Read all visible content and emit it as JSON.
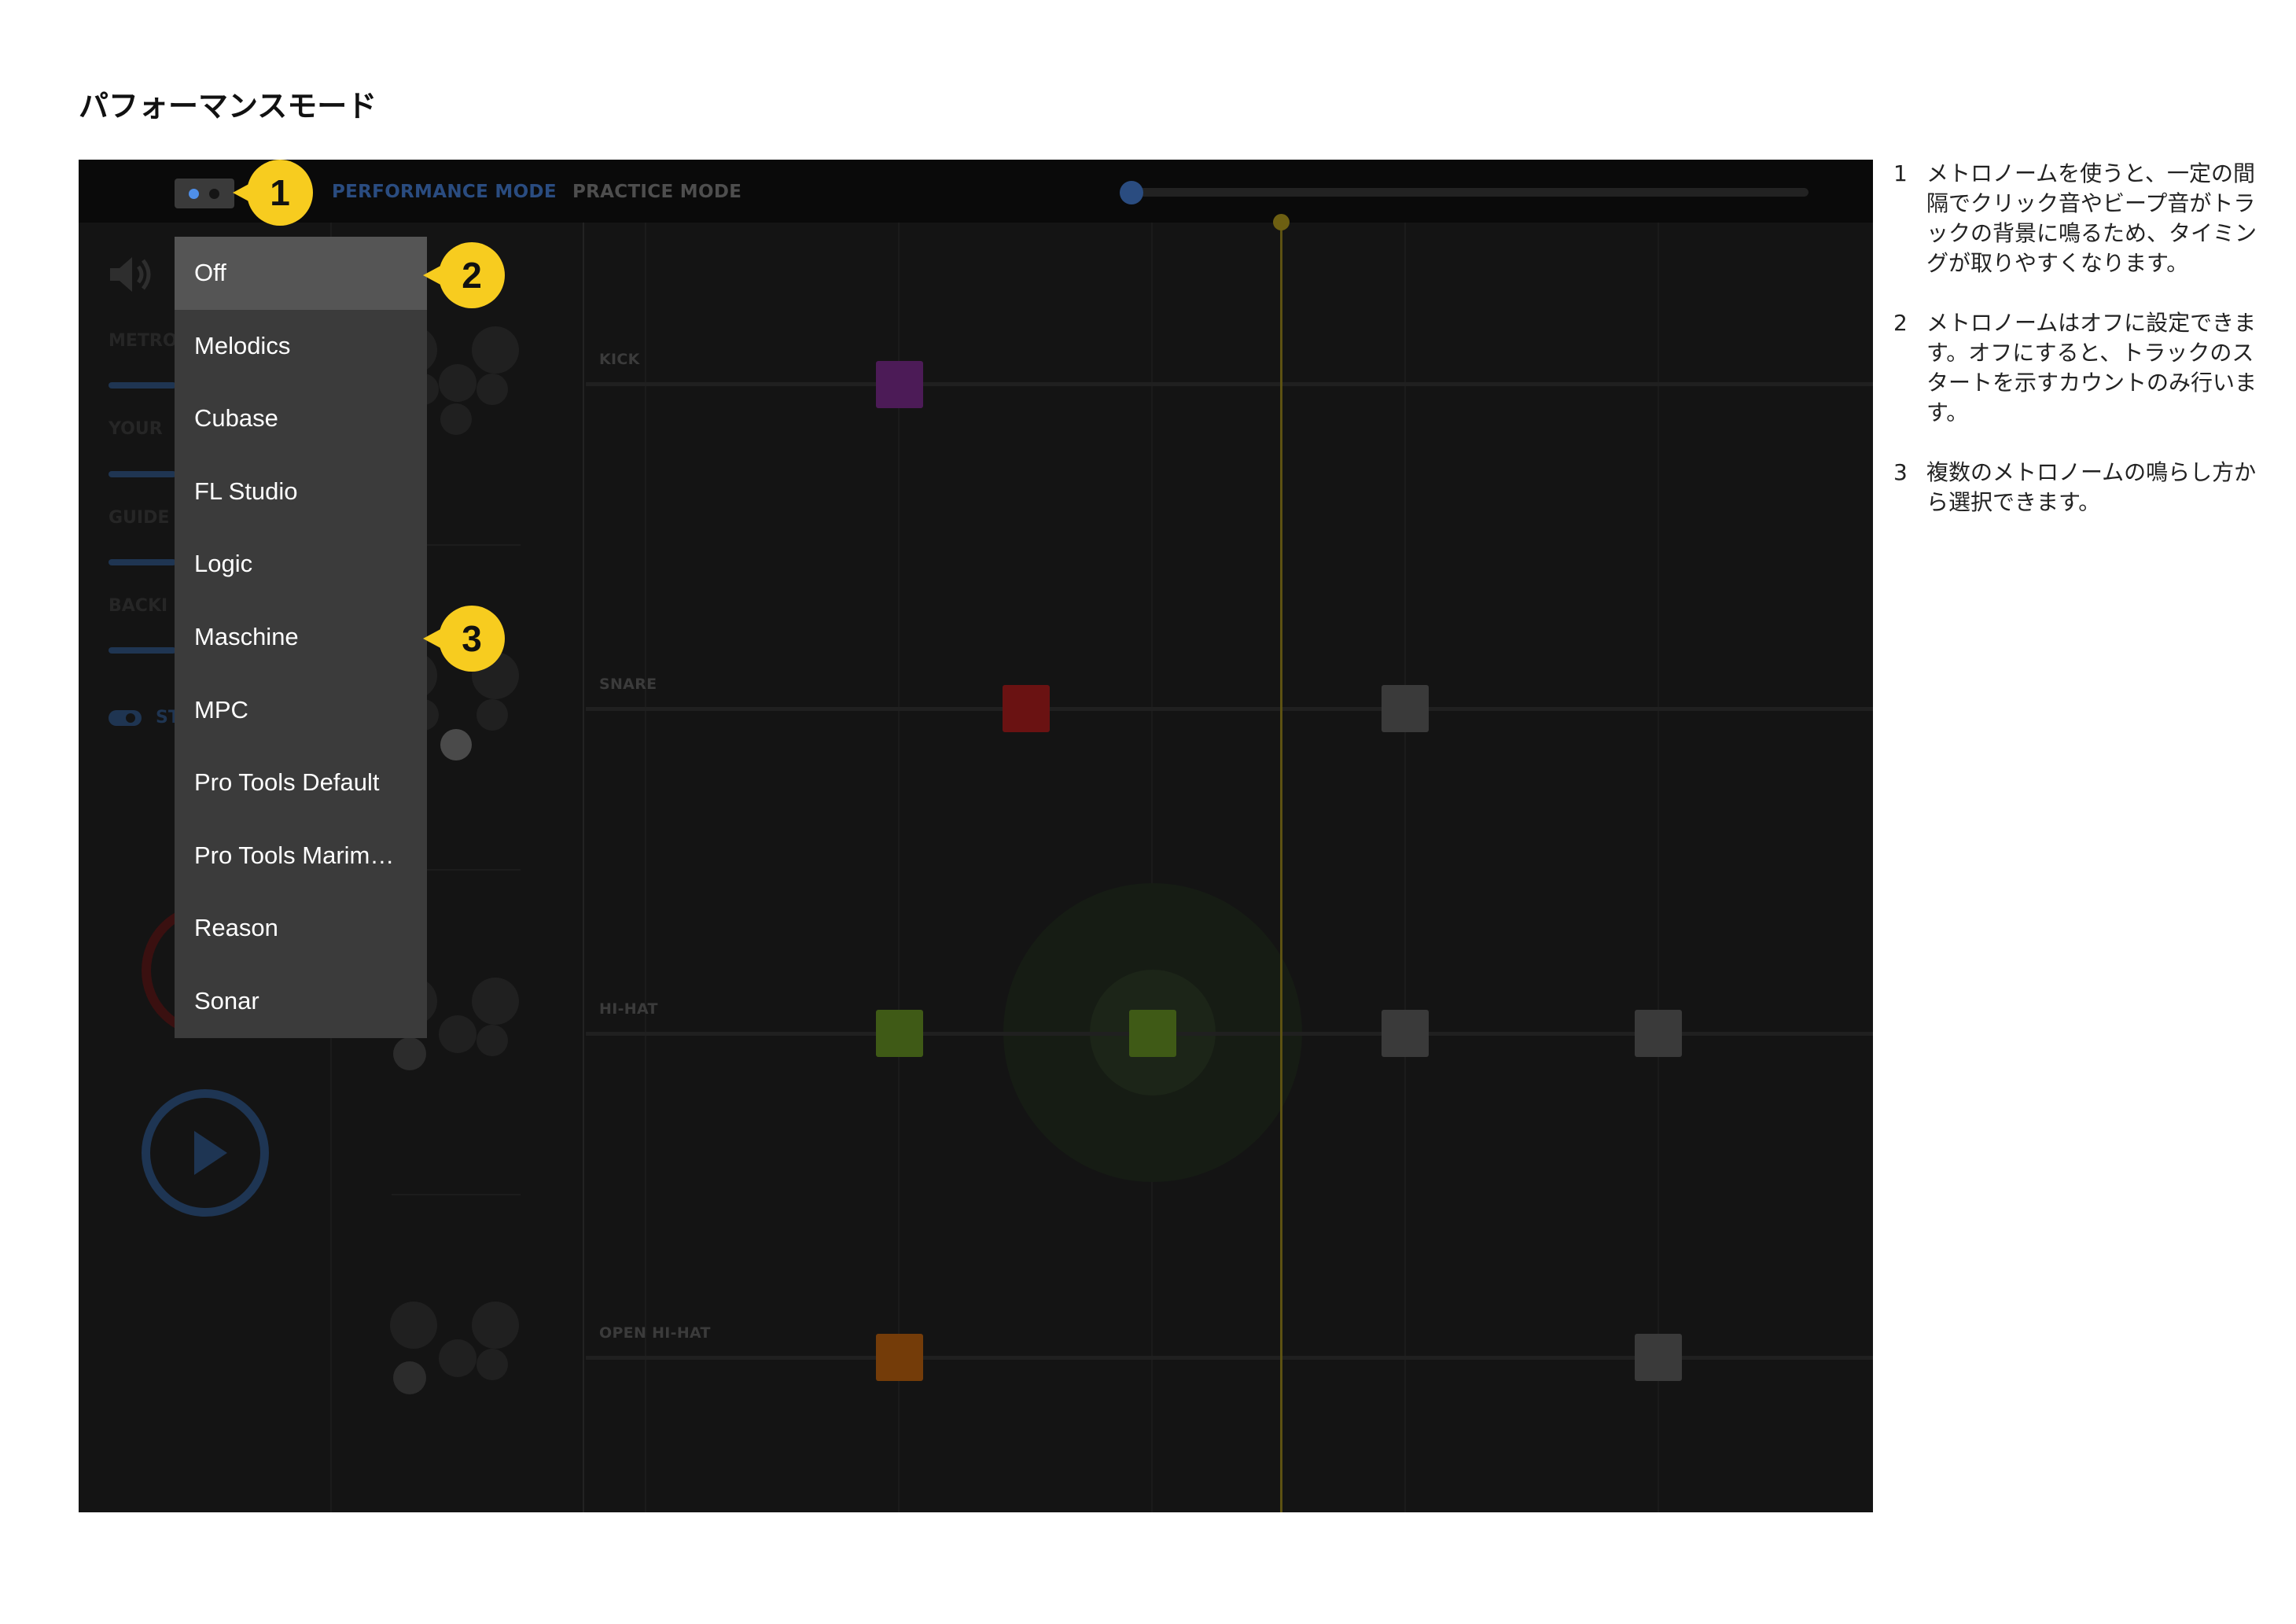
{
  "page": {
    "title": "パフォーマンスモード"
  },
  "header": {
    "modes": [
      "PERFORMANCE MODE",
      "PRACTICE MODE"
    ]
  },
  "sidebar": {
    "labels": [
      "METRO",
      "YOUR",
      "GUIDE",
      "BACKI",
      "ST"
    ]
  },
  "lanes": [
    {
      "label": "KICK"
    },
    {
      "label": "SNARE"
    },
    {
      "label": "HI-HAT"
    },
    {
      "label": "OPEN HI-HAT"
    }
  ],
  "colors": {
    "kick": "#4c1b57",
    "snare": "#6a1212",
    "hihat": "#3f5a16",
    "open_hihat": "#743c09",
    "inactive": "#3a3a3a",
    "callout": "#f7cc1f",
    "accent": "#4f8fe8"
  },
  "metronome_menu": {
    "selected": "Off",
    "items": [
      "Off",
      "Melodics",
      "Cubase",
      "FL Studio",
      "Logic",
      "Maschine",
      "MPC",
      "Pro Tools Default",
      "Pro Tools Marim…",
      "Reason",
      "Sonar"
    ]
  },
  "callouts": [
    "1",
    "2",
    "3"
  ],
  "notes": [
    {
      "num": "1",
      "text": "メトロノームを使うと、一定の間隔でクリック音やビープ音がトラックの背景に鳴るため、タイミングが取りやすくなります。"
    },
    {
      "num": "2",
      "text": "メトロノームはオフに設定できます。オフにすると、トラックのスタートを示すカウントのみ行います。"
    },
    {
      "num": "3",
      "text": "複数のメトロノームの鳴らし方から選択できます。"
    }
  ]
}
